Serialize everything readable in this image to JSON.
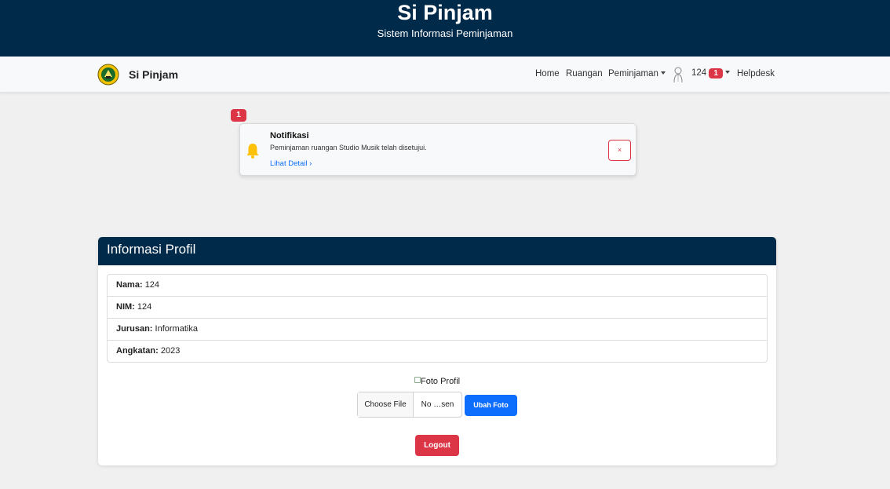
{
  "banner": {
    "title": "Si Pinjam",
    "subtitle": "Sistem Informasi Peminjaman"
  },
  "navbar": {
    "brand": "Si Pinjam",
    "logo_icon": "university-seal-logo",
    "links": {
      "home": "Home",
      "ruangan": "Ruangan",
      "peminjaman": "Peminjaman",
      "user": "124",
      "user_badge": "1",
      "helpdesk": "Helpdesk"
    }
  },
  "notification": {
    "count": "1",
    "title": "Notifikasi",
    "message": "Peminjaman ruangan Studio Musik telah disetujui.",
    "link": "Lihat Detail ›",
    "close": "×"
  },
  "profile": {
    "header": "Informasi Profil",
    "rows": [
      {
        "label": "Nama:",
        "value": "124"
      },
      {
        "label": "NIM:",
        "value": "124"
      },
      {
        "label": "Jurusan:",
        "value": "Informatika"
      },
      {
        "label": "Angkatan:",
        "value": "2023"
      }
    ],
    "photo_alt": "Foto Profil",
    "file_choose": "Choose File",
    "file_status": "No …sen",
    "change_photo": "Ubah Foto",
    "logout": "Logout"
  },
  "colors": {
    "primary_dark": "#002a4a",
    "danger": "#dc3545",
    "primary": "#0d6efd",
    "bell": "#ffc107"
  }
}
